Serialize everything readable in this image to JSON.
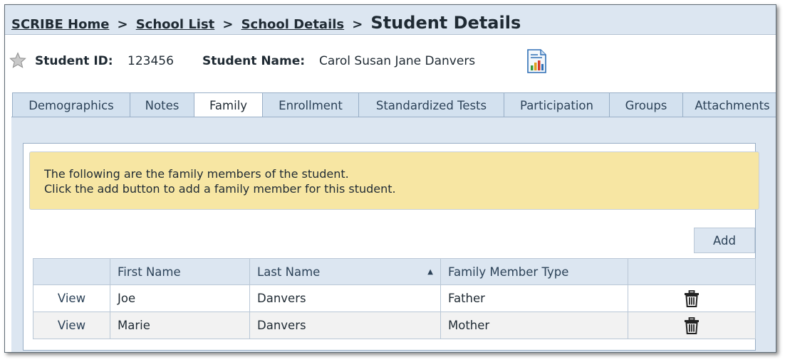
{
  "breadcrumb": {
    "links": [
      "SCRIBE Home",
      "School List",
      "School Details"
    ],
    "separator": ">",
    "current": "Student Details"
  },
  "student": {
    "id_label": "Student ID:",
    "id_value": "123456",
    "name_label": "Student Name:",
    "name_value": "Carol Susan Jane Danvers",
    "icons": [
      "star-icon",
      "report-icon"
    ]
  },
  "tabs": [
    {
      "label": "Demographics"
    },
    {
      "label": "Notes"
    },
    {
      "label": "Family",
      "active": true
    },
    {
      "label": "Enrollment"
    },
    {
      "label": "Standardized Tests"
    },
    {
      "label": "Participation"
    },
    {
      "label": "Groups"
    },
    {
      "label": "Attachments"
    }
  ],
  "info": {
    "line1": "The following are the family members of the student.",
    "line2": "Click the add button to add a family member for this student."
  },
  "add_label": "Add",
  "table": {
    "headers": [
      "",
      "First Name",
      "Last Name",
      "Family Member Type",
      ""
    ],
    "sort_indicator": "▲",
    "rows": [
      {
        "view": "View",
        "first": "Joe",
        "last": "Danvers",
        "type": "Father"
      },
      {
        "view": "View",
        "first": "Marie",
        "last": "Danvers",
        "type": "Mother"
      }
    ]
  },
  "colors": {
    "header_bg": "#dce6f1",
    "info_bg": "#f7e6a3",
    "border": "#98aec6",
    "text": "#1f2a33"
  }
}
